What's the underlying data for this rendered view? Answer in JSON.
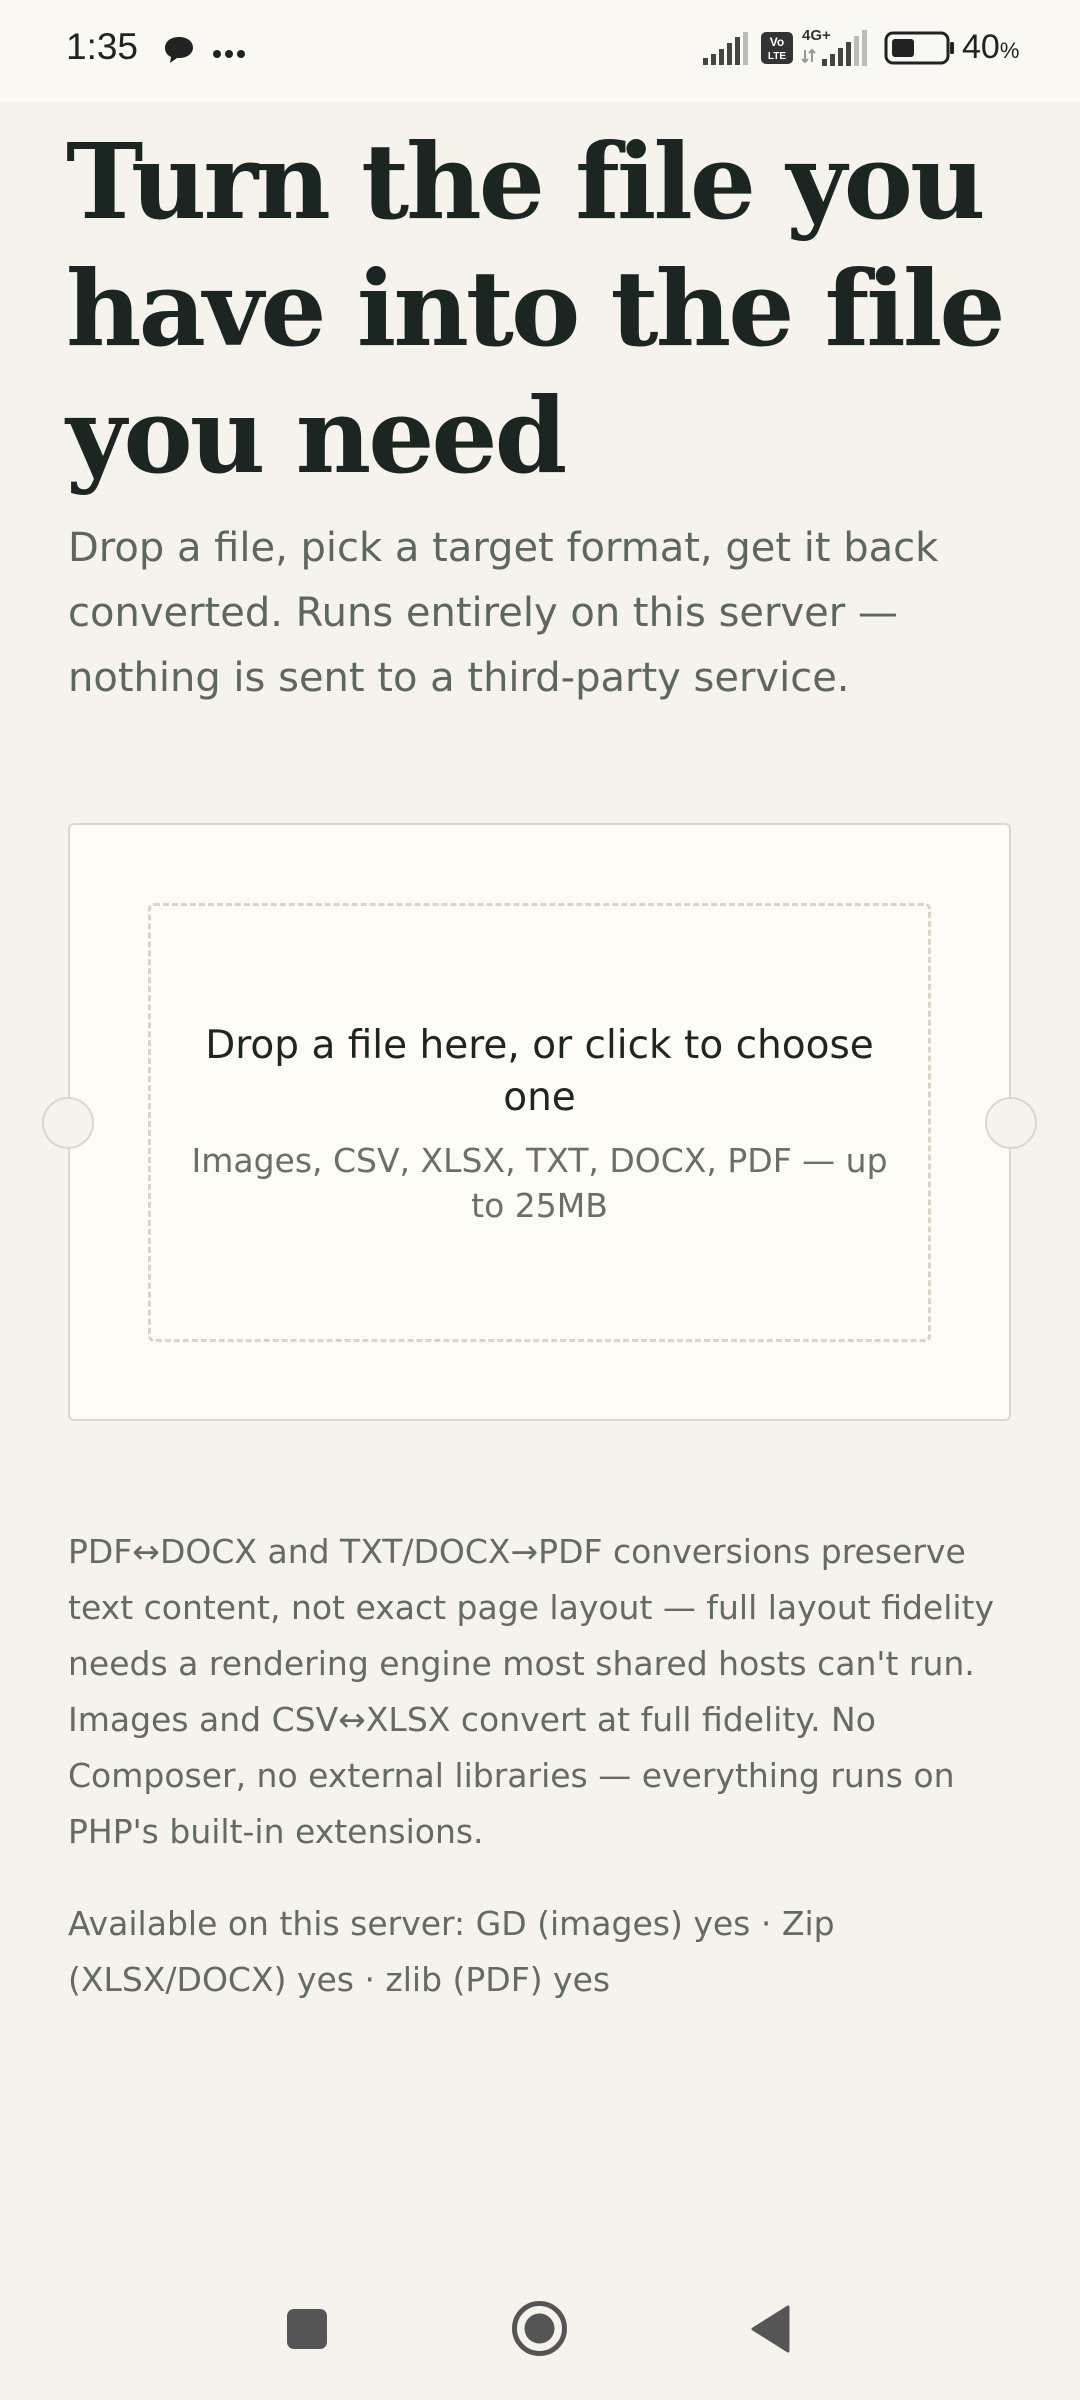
{
  "status_bar": {
    "time": "1:35",
    "battery_percent": "40",
    "percent_sign": "%",
    "network_label": "4G+",
    "volte_label": "Vo LTE",
    "icons": [
      "chat-bubble-icon",
      "more-dots-icon",
      "signal-icon",
      "volte-icon",
      "signal-4g-icon",
      "battery-icon"
    ]
  },
  "hero": {
    "title": "Turn the file you have into the file you need",
    "subtitle": "Drop a file, pick a target format, get it back converted. Runs entirely on this server — nothing is sent to a third-party service."
  },
  "dropzone": {
    "title": "Drop a file here, or click to choose one",
    "hint": "Images, CSV, XLSX, TXT, DOCX, PDF — up to 25MB"
  },
  "notes": {
    "fidelity": "PDF↔DOCX and TXT/DOCX→PDF conversions preserve text content, not exact page layout — full layout fidelity needs a rendering engine most shared hosts can't run. Images and CSV↔XLSX convert at full fidelity. No Composer, no external libraries — everything runs on PHP's built-in extensions.",
    "availability": "Available on this server: GD (images) yes · Zip (XLSX/DOCX) yes · zlib (PDF) yes"
  },
  "nav_bar": {
    "buttons": [
      "recent-apps-icon",
      "home-icon",
      "back-icon"
    ]
  },
  "colors": {
    "background": "#f5f3ec",
    "heading": "#1b2521",
    "muted_text": "#5e6660",
    "card_border": "#dcd8c9"
  }
}
